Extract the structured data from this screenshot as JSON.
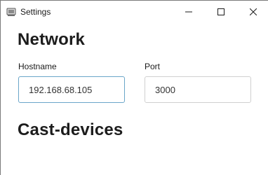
{
  "window": {
    "title": "Settings",
    "icon": "app-icon"
  },
  "network": {
    "heading": "Network",
    "hostname": {
      "label": "Hostname",
      "value": "192.168.68.105"
    },
    "port": {
      "label": "Port",
      "value": "3000"
    }
  },
  "cast": {
    "heading": "Cast-devices"
  },
  "colors": {
    "focused_border": "#6aa6c9",
    "input_border": "#d0d0d0"
  }
}
